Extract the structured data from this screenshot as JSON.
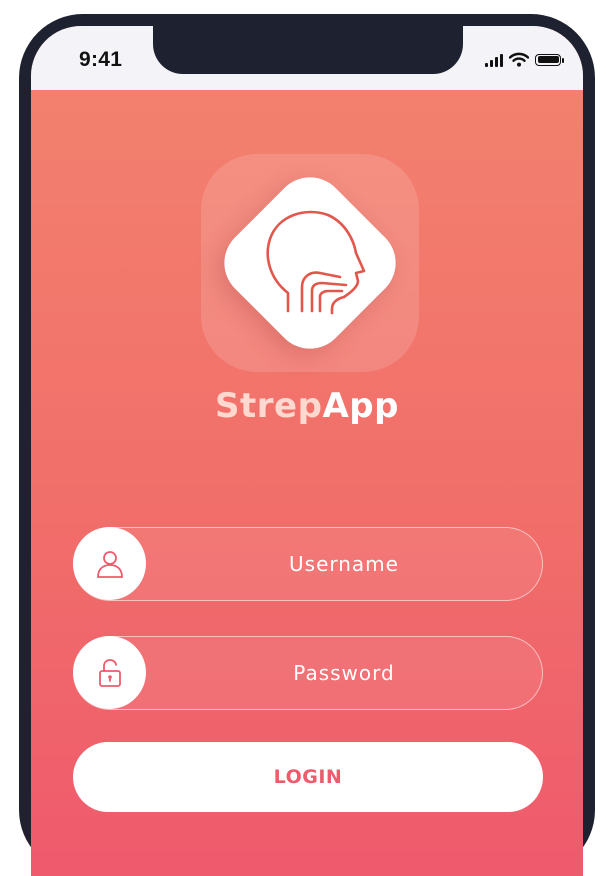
{
  "status_bar": {
    "time": "9:41",
    "icons": [
      "cellular-signal-icon",
      "wifi-icon",
      "battery-icon"
    ]
  },
  "app": {
    "name_part1": "Strep",
    "name_part2": "App",
    "logo_icon": "head-throat-icon"
  },
  "form": {
    "username": {
      "placeholder": "Username",
      "icon": "user-icon"
    },
    "password": {
      "placeholder": "Password",
      "icon": "unlock-icon"
    },
    "login_label": "LOGIN"
  },
  "colors": {
    "gradient_top": "#f3836f",
    "gradient_bottom": "#ef5a6c",
    "accent": "#ef5a6c",
    "frame": "#1e2230",
    "title_light": "#ffd9cf"
  }
}
